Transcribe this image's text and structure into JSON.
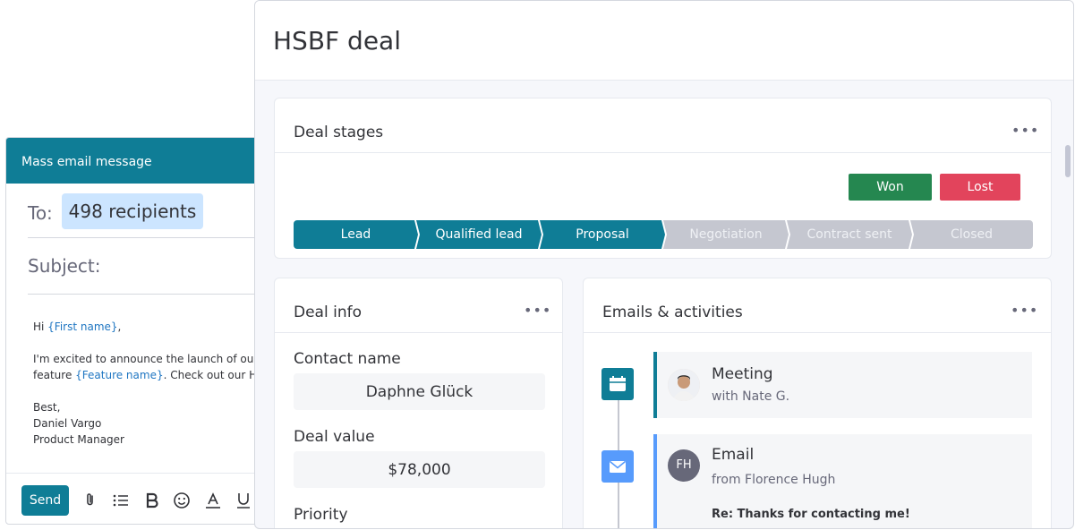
{
  "email": {
    "header_title": "Mass email message",
    "to_label": "To:",
    "recipients": "498 recipients",
    "subject_label": "Subject:",
    "greeting": "Hi ",
    "first_name_var": "{First name}",
    "greeting_end": ",",
    "body_line1": "I'm excited to announce the launch of our ne",
    "body_line2_a": "feature ",
    "feature_var": "{Feature name}",
    "body_line2_b": ". Check out our Help",
    "sign_best": "Best,",
    "sign_name": "Daniel Vargo",
    "sign_role": "Product Manager",
    "send_label": "Send",
    "toolbar_icons": [
      "paperclip-icon",
      "list-icon",
      "bold-icon",
      "emoji-icon",
      "text-color-icon",
      "underline-icon"
    ]
  },
  "deal": {
    "title": "HSBF deal",
    "stages_card": {
      "title": "Deal stages",
      "won_label": "Won",
      "lost_label": "Lost",
      "stages": [
        {
          "label": "Lead",
          "state": "completed"
        },
        {
          "label": "Qualified lead",
          "state": "completed"
        },
        {
          "label": "Proposal",
          "state": "completed"
        },
        {
          "label": "Negotiation",
          "state": "pending"
        },
        {
          "label": "Contract sent",
          "state": "pending"
        },
        {
          "label": "Closed",
          "state": "pending"
        }
      ],
      "colors": {
        "active": "#0f7d96",
        "inactive": "#c5c7d0",
        "won": "#258750",
        "lost": "#e2445c"
      }
    },
    "info_card": {
      "title": "Deal info",
      "contact_label": "Contact name",
      "contact_value": "Daphne Glück",
      "value_label": "Deal value",
      "value_value": "$78,000",
      "priority_label": "Priority"
    },
    "activities_card": {
      "title": "Emails & activities",
      "items": [
        {
          "type": "meeting",
          "icon": "calendar-icon",
          "title": "Meeting",
          "subtitle": "with Nate G."
        },
        {
          "type": "email",
          "icon": "mail-icon",
          "title": "Email",
          "subtitle": "from Florence Hugh",
          "avatar_initials": "FH",
          "message": "Re: Thanks for contacting me!"
        }
      ]
    }
  }
}
